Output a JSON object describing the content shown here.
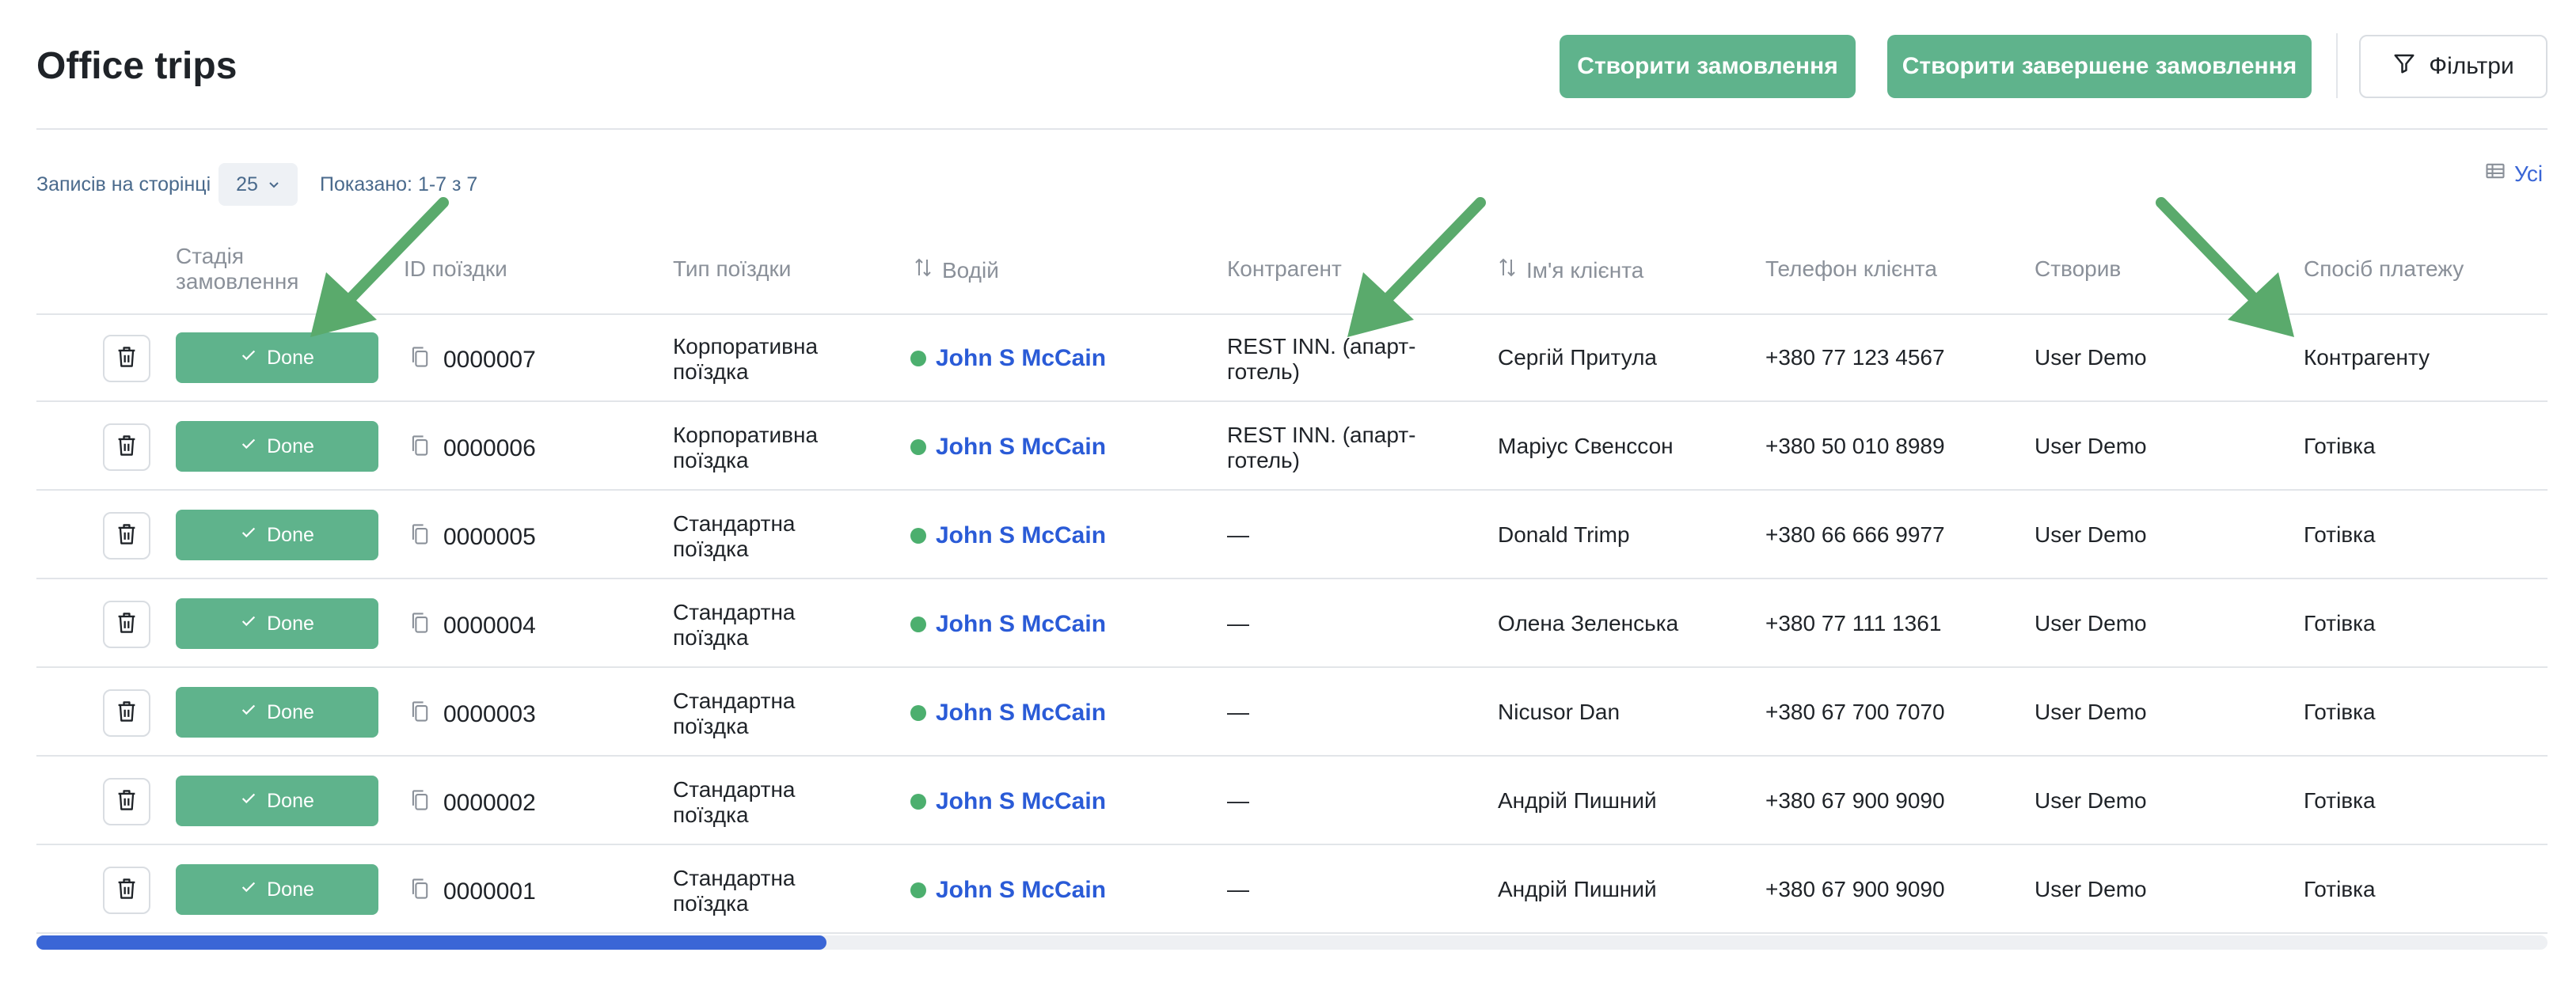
{
  "page": {
    "title": "Office trips"
  },
  "toolbar": {
    "create_label": "Створити замовлення",
    "create_completed_label": "Створити завершене замовлення",
    "filters_label": "Фільтри"
  },
  "pagination": {
    "per_page_label": "Записів на сторінці",
    "per_page_value": "25",
    "shown_label": "Показано: 1-7 з 7"
  },
  "columns_toggle": {
    "label": "Усі",
    "icon": "table-icon"
  },
  "table": {
    "headers": {
      "stage_line1": "Стадія",
      "stage_line2": "замовлення",
      "trip_id": "ID поїздки",
      "trip_type": "Тип поїздки",
      "driver": "Водій",
      "contractor": "Контрагент",
      "client_name": "Ім'я клієнта",
      "client_phone": "Телефон клієнта",
      "created_by": "Створив",
      "payment_method": "Спосіб платежу"
    },
    "rows": [
      {
        "stage": "Done",
        "id": "0000007",
        "type_line1": "Корпоративна",
        "type_line2": "поїздка",
        "driver": "John S McCain",
        "contractor_line1": "REST INN. (апарт-",
        "contractor_line2": "готель)",
        "client": "Сергій Притула",
        "phone": "+380 77 123 4567",
        "created_by": "User Demo",
        "payment": "Контрагенту"
      },
      {
        "stage": "Done",
        "id": "0000006",
        "type_line1": "Корпоративна",
        "type_line2": "поїздка",
        "driver": "John S McCain",
        "contractor_line1": "REST INN. (апарт-",
        "contractor_line2": "готель)",
        "client": "Маріус Свенссон",
        "phone": "+380 50 010 8989",
        "created_by": "User Demo",
        "payment": "Готівка"
      },
      {
        "stage": "Done",
        "id": "0000005",
        "type_line1": "Стандартна",
        "type_line2": "поїздка",
        "driver": "John S McCain",
        "contractor_line1": "—",
        "contractor_line2": "",
        "client": "Donald Trimp",
        "phone": "+380 66 666 9977",
        "created_by": "User Demo",
        "payment": "Готівка"
      },
      {
        "stage": "Done",
        "id": "0000004",
        "type_line1": "Стандартна",
        "type_line2": "поїздка",
        "driver": "John S McCain",
        "contractor_line1": "—",
        "contractor_line2": "",
        "client": "Олена Зеленська",
        "phone": "+380 77 111 1361",
        "created_by": "User Demo",
        "payment": "Готівка"
      },
      {
        "stage": "Done",
        "id": "0000003",
        "type_line1": "Стандартна",
        "type_line2": "поїздка",
        "driver": "John S McCain",
        "contractor_line1": "—",
        "contractor_line2": "",
        "client": "Nicusor Dan",
        "phone": "+380 67 700 7070",
        "created_by": "User Demo",
        "payment": "Готівка"
      },
      {
        "stage": "Done",
        "id": "0000002",
        "type_line1": "Стандартна",
        "type_line2": "поїздка",
        "driver": "John S McCain",
        "contractor_line1": "—",
        "contractor_line2": "",
        "client": "Андрій Пишний",
        "phone": "+380 67 900 9090",
        "created_by": "User Demo",
        "payment": "Готівка"
      },
      {
        "stage": "Done",
        "id": "0000001",
        "type_line1": "Стандартна",
        "type_line2": "поїздка",
        "driver": "John S McCain",
        "contractor_line1": "—",
        "contractor_line2": "",
        "client": "Андрій Пишний",
        "phone": "+380 67 900 9090",
        "created_by": "User Demo",
        "payment": "Готівка"
      }
    ]
  },
  "colors": {
    "accent_green": "#5fb38c",
    "link_blue": "#2a5bd7",
    "status_dot": "#4caf6e",
    "annotation_arrow": "#5aaa6c"
  }
}
